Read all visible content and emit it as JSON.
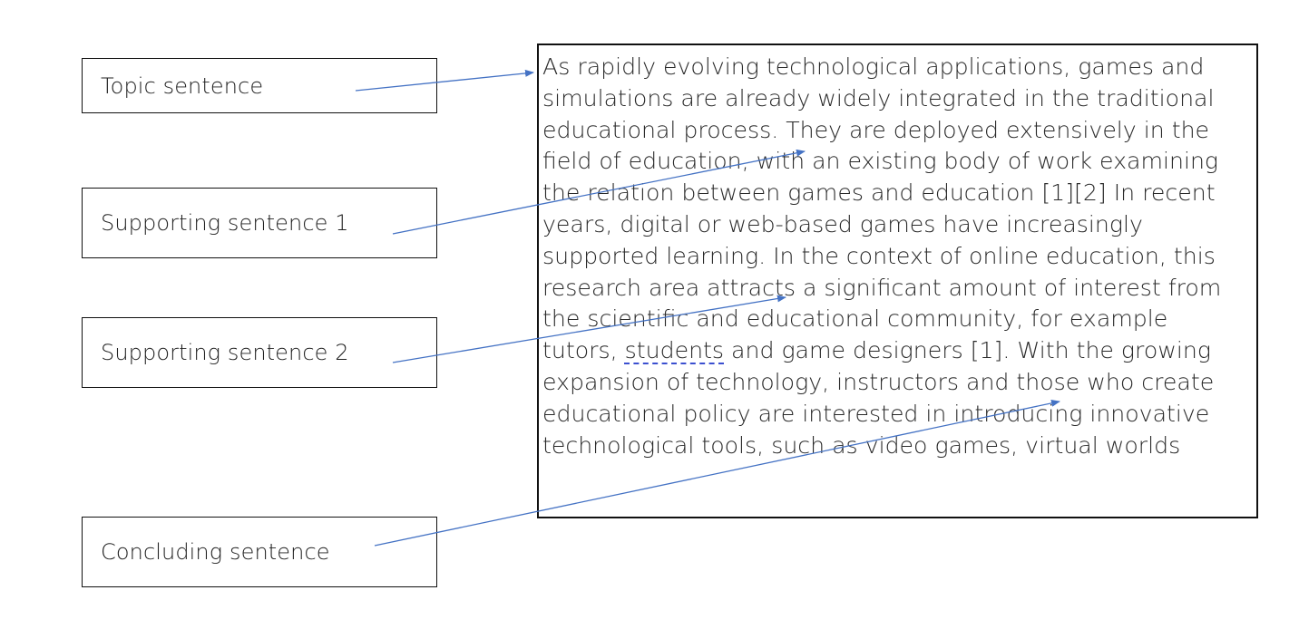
{
  "labels": {
    "topic": "Topic sentence",
    "supporting_1": "Supporting sentence 1",
    "supporting_2": "Supporting sentence 2",
    "concluding": "Concluding sentence"
  },
  "paragraph": {
    "lines": [
      "As rapidly evolving technological applications, games and",
      "simulations are already widely integrated in the traditional",
      "educational process. They are deployed extensively in the",
      "field of education, with an existing body of work examining",
      "the relation between games and education [1][2] In recent",
      "years, digital or web-based games have increasingly",
      "supported learning. In the context of online education, this",
      "research area attracts a significant amount of interest from",
      "the scientific and educational community, for example",
      "tutors, ",
      "students",
      " and game designers [1]. With the growing",
      "expansion of technology, instructors and those who create",
      "educational policy are interested in introducing innovative",
      "technological tools, such as video games, virtual worlds"
    ]
  },
  "colors": {
    "arrow": "#4472c4",
    "border": "#111111",
    "spellcheck_underline": "#3b4fd0"
  }
}
